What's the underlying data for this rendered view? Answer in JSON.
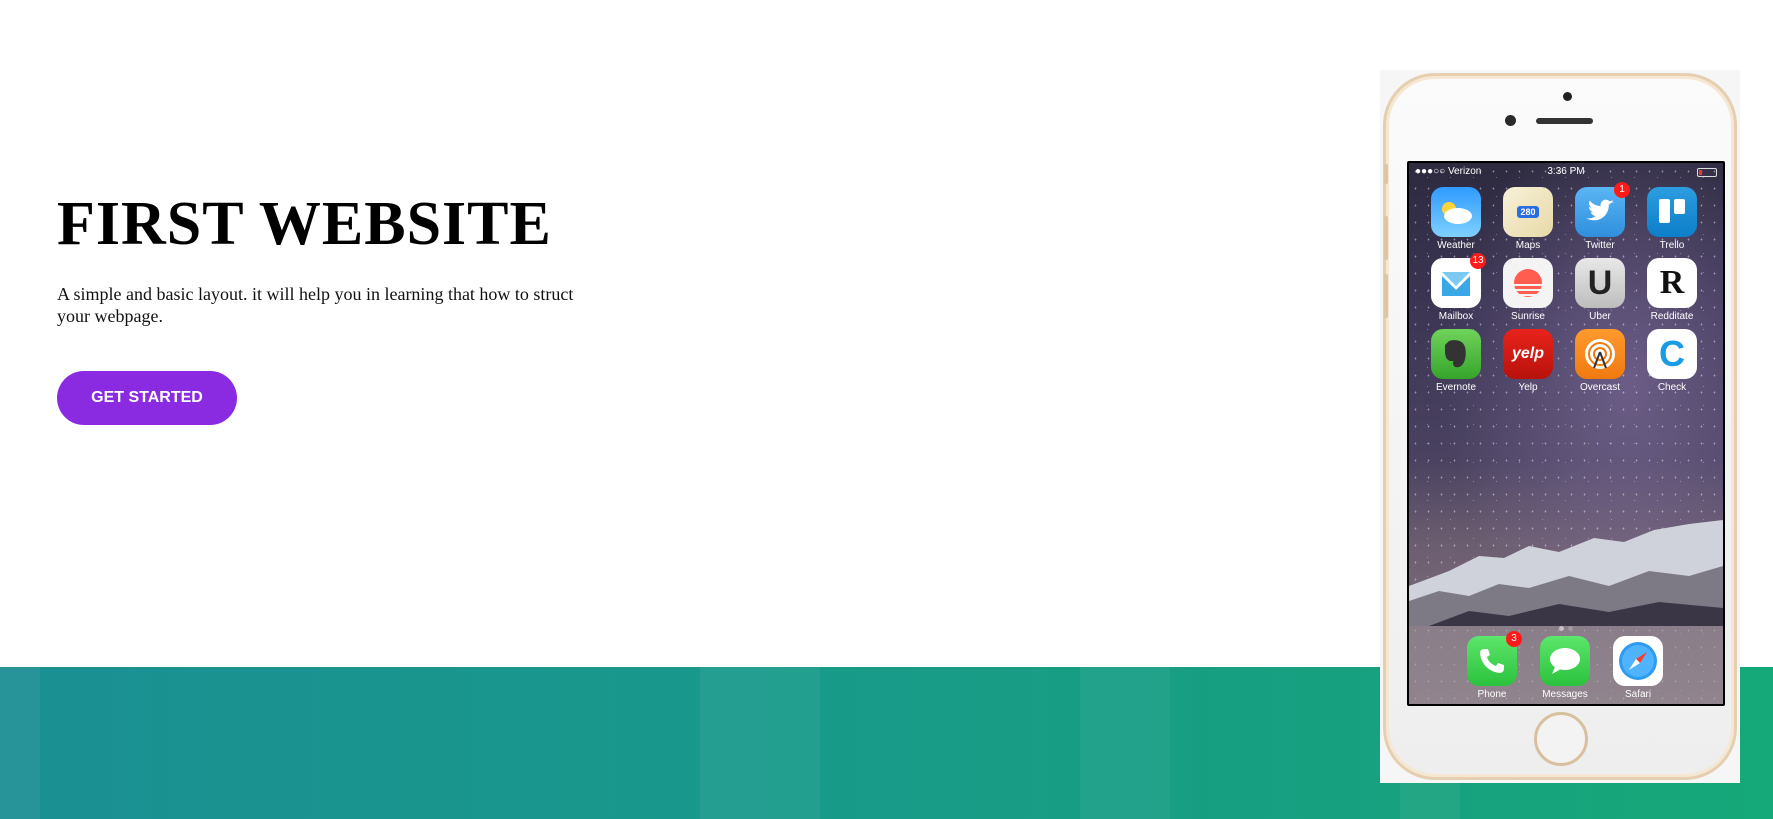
{
  "hero": {
    "title": "FIRST WEBSITE",
    "description": "A simple and basic layout. it will help you in learning that how to struct your webpage.",
    "cta_label": "GET STARTED"
  },
  "colors": {
    "accent": "#8a2be2",
    "band_start": "#1b8f93",
    "band_end": "#15a878"
  },
  "phone": {
    "status": {
      "carrier": "●●●○○ Verizon",
      "time": "3:36 PM"
    },
    "apps": [
      {
        "label": "Weather",
        "icon": "weather-icon"
      },
      {
        "label": "Maps",
        "icon": "maps-icon",
        "glyph": "280"
      },
      {
        "label": "Twitter",
        "icon": "twitter-icon",
        "badge": "1"
      },
      {
        "label": "Trello",
        "icon": "trello-icon"
      },
      {
        "label": "Mailbox",
        "icon": "mailbox-icon",
        "badge": "13"
      },
      {
        "label": "Sunrise",
        "icon": "sunrise-icon"
      },
      {
        "label": "Uber",
        "icon": "uber-icon",
        "glyph": "U"
      },
      {
        "label": "Redditate",
        "icon": "redditate-icon",
        "glyph": "R"
      },
      {
        "label": "Evernote",
        "icon": "evernote-icon"
      },
      {
        "label": "Yelp",
        "icon": "yelp-icon",
        "glyph": "yelp"
      },
      {
        "label": "Overcast",
        "icon": "overcast-icon"
      },
      {
        "label": "Check",
        "icon": "check-icon",
        "glyph": "C"
      }
    ],
    "dock": [
      {
        "label": "Phone",
        "icon": "phone-icon",
        "badge": "3"
      },
      {
        "label": "Messages",
        "icon": "messages-icon"
      },
      {
        "label": "Safari",
        "icon": "safari-icon"
      }
    ]
  }
}
